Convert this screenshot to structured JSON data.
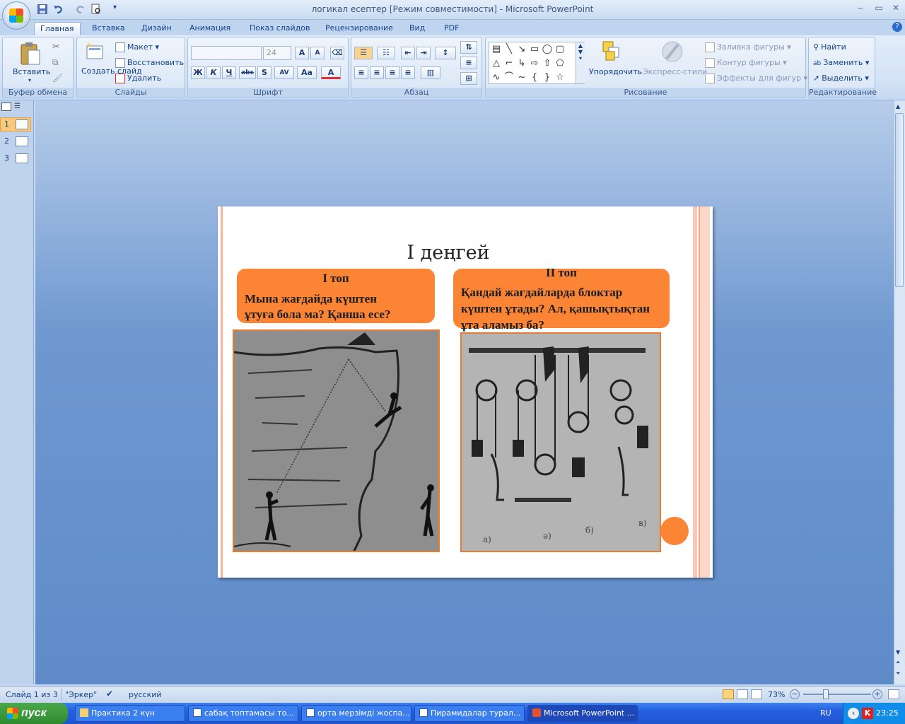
{
  "window": {
    "title": "логикал есептер [Режим совместимости] - Microsoft PowerPoint",
    "minimize": "‒",
    "restore": "▭",
    "close": "✕"
  },
  "tabs": [
    "Главная",
    "Вставка",
    "Дизайн",
    "Анимация",
    "Показ слайдов",
    "Рецензирование",
    "Вид",
    "PDF"
  ],
  "ribbon": {
    "clipboard": {
      "paste": "Вставить",
      "label": "Буфер обмена"
    },
    "slides": {
      "create": "Создать слайд",
      "layout": "Макет",
      "reset": "Восстановить",
      "delete": "Удалить",
      "label": "Слайды"
    },
    "font": {
      "size": "24",
      "label": "Шрифт"
    },
    "paragraph": {
      "label": "Абзац"
    },
    "drawing": {
      "arrange": "Упорядочить",
      "express_styles": "Экспресс-стили",
      "fill": "Заливка фигуры",
      "outline": "Контур фигуры",
      "effects": "Эффекты для фигур",
      "label": "Рисование"
    },
    "editing": {
      "find": "Найти",
      "replace": "Заменить",
      "select": "Выделить",
      "label": "Редактирование"
    }
  },
  "slide_pane": {
    "items": [
      "1",
      "2",
      "3"
    ]
  },
  "slide": {
    "title": "I деңгей",
    "group1": {
      "heading": "I топ",
      "question": "Мына жағдайда күштен ұтуға бола ма? Қанша есе?"
    },
    "group2": {
      "heading": "II топ",
      "question": "Қандай жағдайларда блоктар күштен ұтады? Ал, қашықтықтан ұта аламыз ба?"
    },
    "pulley_labels": [
      "а)",
      "ә)",
      "б)",
      "в)"
    ]
  },
  "status": {
    "slide": "Слайд 1 из 3",
    "theme": "\"Эркер\"",
    "language": "русский",
    "zoom": "73%"
  },
  "taskbar": {
    "start": "пуск",
    "tasks": [
      "Практика 2 күн",
      "сабақ топтамасы то...",
      "орта мерзімді жоспа...",
      "Пирамидалар турал...",
      "Microsoft PowerPoint ..."
    ],
    "lang": "RU",
    "time": "23:25"
  },
  "colors": {
    "accent_orange": "#fb8535",
    "ribbon_blue": "#d3e2f5",
    "workspace": "#6f98d0"
  }
}
